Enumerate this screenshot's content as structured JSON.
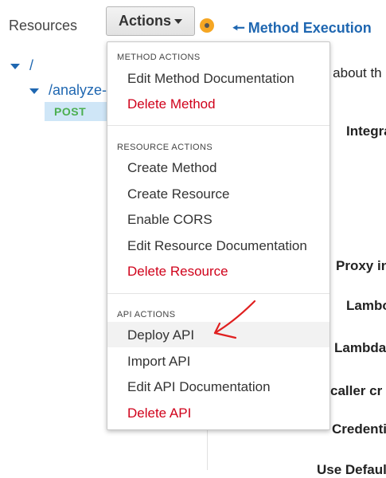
{
  "sidebar": {
    "title": "Resources",
    "root_path": "/",
    "child_path": "/analyze-",
    "method": "POST"
  },
  "toolbar": {
    "actions_label": "Actions"
  },
  "header": {
    "method_execution": "Method Execution"
  },
  "background_text": {
    "line1": "n about th",
    "integra": "Integra",
    "proxy": "Proxy in",
    "lambo": "Lambo",
    "lambda": "Lambda",
    "caller": "caller cr",
    "credentials": "Credenti",
    "use_default": "Use Defaul"
  },
  "menu": {
    "method_actions_header": "METHOD ACTIONS",
    "edit_method_doc": "Edit Method Documentation",
    "delete_method": "Delete Method",
    "resource_actions_header": "RESOURCE ACTIONS",
    "create_method": "Create Method",
    "create_resource": "Create Resource",
    "enable_cors": "Enable CORS",
    "edit_resource_doc": "Edit Resource Documentation",
    "delete_resource": "Delete Resource",
    "api_actions_header": "API ACTIONS",
    "deploy_api": "Deploy API",
    "import_api": "Import API",
    "edit_api_doc": "Edit API Documentation",
    "delete_api": "Delete API"
  },
  "colors": {
    "link": "#1f67b1",
    "danger": "#d0021b",
    "post": "#4caf50",
    "annotation": "#e02020"
  }
}
